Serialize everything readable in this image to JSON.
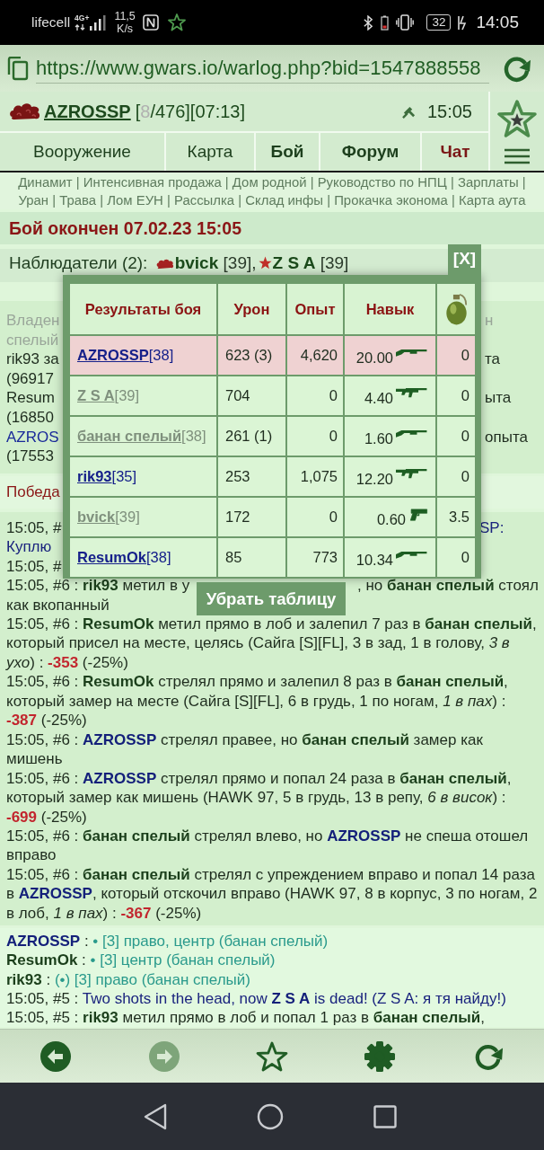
{
  "status_bar": {
    "carrier": "lifecell",
    "network": "4G+",
    "speed": "11,5",
    "speed_unit": "K/s",
    "battery": "32",
    "time": "14:05"
  },
  "address_bar": {
    "url": "https://www.gwars.io/warlog.php?bid=1547888558"
  },
  "header": {
    "player": "AZROSSP",
    "stats": {
      "before": "[",
      "hp": "8",
      "after": "/476][07:13]"
    },
    "time": "15:05",
    "nav": [
      {
        "label": "Вооружение",
        "kind": "plain"
      },
      {
        "label": "Карта",
        "kind": "plain"
      },
      {
        "label": "Бой",
        "kind": "bold"
      },
      {
        "label": "Форум",
        "kind": "bold"
      },
      {
        "label": "Чат",
        "kind": "alert"
      }
    ]
  },
  "quick_links": [
    {
      "label": "Динамит",
      "separator": "|"
    },
    {
      "label": "Интенсивная продажа",
      "separator": "|"
    },
    {
      "label": "Дом родной",
      "separator": "|"
    },
    {
      "label": "Руководство по НПЦ",
      "separator": "|"
    },
    {
      "label": "Зарплаты",
      "separator": "|"
    },
    {
      "label": "Уран",
      "separator": "|"
    },
    {
      "label": "Трава",
      "separator": "|"
    },
    {
      "label": "Лом ЕУН",
      "separator": "|"
    },
    {
      "label": "Рассылка",
      "separator": "|"
    },
    {
      "label": "Склад инфы",
      "separator": "|"
    },
    {
      "label": "Прокачка эконома",
      "separator": "|"
    },
    {
      "label": "Карта аута"
    }
  ],
  "battle": {
    "title": "Бой окончен 07.02.23 15:05",
    "observers": {
      "label": "Наблюдатели (2):",
      "players": [
        {
          "name": "bvick",
          "level": "[39],",
          "clan": {
            "kind": "cloud"
          }
        },
        {
          "name": "Z S A",
          "level": "[39]",
          "clan": {
            "kind": "star"
          }
        }
      ]
    },
    "summary_lines": [
      {
        "left": [
          {
            "text": "Владен",
            "kind": "muted"
          }
        ],
        "right": [
          {
            "text": "н",
            "kind": "muted"
          }
        ]
      },
      {
        "left": [
          {
            "text": "спелый",
            "kind": "muted"
          }
        ]
      },
      {
        "left": [
          {
            "text": "rik93 за"
          }
        ],
        "right": [
          {
            "text": "та"
          }
        ]
      },
      {
        "left": [
          {
            "text": "(96917"
          }
        ]
      },
      {
        "left": [
          {
            "text": "Resum"
          }
        ],
        "right": [
          {
            "text": "ыта"
          }
        ]
      },
      {
        "left": [
          {
            "text": "(16850"
          }
        ]
      },
      {
        "left": [
          {
            "text": "AZROS",
            "kind": "name"
          }
        ],
        "right": [
          {
            "text": "опыта"
          }
        ]
      },
      {
        "left": [
          {
            "text": "(17553"
          }
        ]
      }
    ],
    "victory": "Победа",
    "covered_lines": [
      {
        "left": [
          {
            "text": "15:05, #"
          }
        ],
        "right": [
          {
            "text": "SP:",
            "kind": "message"
          }
        ]
      },
      {
        "left": [
          {
            "text": "Куплю",
            "kind": "message"
          }
        ]
      },
      {
        "left": [
          {
            "text": "15:05, #"
          }
        ]
      }
    ],
    "button_line": {
      "left": [
        {
          "text": "15:05, #6 : "
        },
        {
          "text": "rik93",
          "kind": "player",
          "color": "#1b3f1b"
        },
        {
          "text": " метил в у"
        }
      ],
      "right": [
        {
          "text": ", но "
        },
        {
          "text": "банан спелый",
          "kind": "player",
          "color": "#1b3f1b"
        },
        {
          "text": " стоял"
        }
      ]
    },
    "entries": [
      {
        "segments": [
          {
            "text": "как вкопанный"
          }
        ]
      },
      {
        "segments": [
          {
            "text": "15:05, #6 : "
          },
          {
            "text": "ResumOk",
            "kind": "player",
            "color": "#1b3f1b"
          },
          {
            "text": " метил прямо в лоб и залепил 7 раз в "
          },
          {
            "text": "банан спелый",
            "kind": "player",
            "color": "#1b3f1b"
          },
          {
            "text": ", который присел на месте, целясь (Сайга [S][FL], 3 в зад, 1 в голову, "
          },
          {
            "text": "3 в ухо",
            "kind": "italic"
          },
          {
            "text": ") : "
          },
          {
            "text": "-353",
            "kind": "damage"
          },
          {
            "text": " (-25%)"
          }
        ]
      },
      {
        "segments": [
          {
            "text": "15:05, #6 : "
          },
          {
            "text": "ResumOk",
            "kind": "player",
            "color": "#1b3f1b"
          },
          {
            "text": " стрелял прямо и залепил 8 раз в "
          },
          {
            "text": "банан спелый",
            "kind": "player",
            "color": "#1b3f1b"
          },
          {
            "text": ", который замер на месте (Сайга [S][FL], 6 в грудь, 1 по ногам, "
          },
          {
            "text": "1 в пах",
            "kind": "italic"
          },
          {
            "text": ") : "
          },
          {
            "text": "-387",
            "kind": "damage"
          },
          {
            "text": " (-25%)"
          }
        ]
      },
      {
        "segments": [
          {
            "text": "15:05, #6 : "
          },
          {
            "text": "AZROSSP",
            "kind": "player",
            "color": "#14207a"
          },
          {
            "text": " стрелял правее, но "
          },
          {
            "text": "банан спелый",
            "kind": "player",
            "color": "#1b3f1b"
          },
          {
            "text": " замер как мишень"
          }
        ]
      },
      {
        "segments": [
          {
            "text": "15:05, #6 : "
          },
          {
            "text": "AZROSSP",
            "kind": "player",
            "color": "#14207a"
          },
          {
            "text": " стрелял прямо и попал 24 раза в "
          },
          {
            "text": "банан спелый",
            "kind": "player",
            "color": "#1b3f1b"
          },
          {
            "text": ", который замер как мишень (HAWK 97, 5 в грудь, 13 в репу, "
          },
          {
            "text": "6 в висок",
            "kind": "italic"
          },
          {
            "text": ") : "
          },
          {
            "text": "-699",
            "kind": "damage"
          },
          {
            "text": " (-25%)"
          }
        ]
      },
      {
        "segments": [
          {
            "text": "15:05, #6 : "
          },
          {
            "text": "банан спелый",
            "kind": "player",
            "color": "#1b3f1b"
          },
          {
            "text": " стрелял влево, но "
          },
          {
            "text": "AZROSSP",
            "kind": "player",
            "color": "#14207a"
          },
          {
            "text": " не спеша отошел вправо"
          }
        ]
      },
      {
        "segments": [
          {
            "text": "15:05, #6 : "
          },
          {
            "text": "банан спелый",
            "kind": "player",
            "color": "#1b3f1b"
          },
          {
            "text": " стрелял с упреждением вправо и попал 14 раза в "
          },
          {
            "text": "AZROSSP",
            "kind": "player",
            "color": "#14207a"
          },
          {
            "text": ", который отскочил вправо (HAWK 97, 8 в корпус, 3 по ногам, 2 в лоб, "
          },
          {
            "text": "1 в пах",
            "kind": "italic"
          },
          {
            "text": ") : "
          },
          {
            "text": "-367",
            "kind": "damage"
          },
          {
            "text": " (-25%)"
          }
        ]
      }
    ],
    "aim_lines": [
      {
        "segments": [
          {
            "text": "AZROSSP",
            "kind": "player",
            "color": "#14207a"
          },
          {
            "text": " : "
          },
          {
            "text": "• [3] право, центр (банан спелый)",
            "kind": "aim"
          }
        ]
      },
      {
        "segments": [
          {
            "text": "ResumOk",
            "kind": "player",
            "color": "#1b3f1b"
          },
          {
            "text": " : "
          },
          {
            "text": "• [3] центр (банан спелый)",
            "kind": "aim"
          }
        ]
      },
      {
        "segments": [
          {
            "text": "rik93",
            "kind": "player",
            "color": "#1b3f1b"
          },
          {
            "text": " : "
          },
          {
            "text": "(•) [3] право (банан спелый)",
            "kind": "aim"
          }
        ]
      },
      {
        "segments": [
          {
            "text": "15:05, #5 : "
          },
          {
            "text": "Two shots in the head, now ",
            "kind": "message"
          },
          {
            "text": "Z S A",
            "kind": "player",
            "color": "#14207a"
          },
          {
            "text": " is dead! (Z S A: я тя найду!)",
            "kind": "message"
          }
        ]
      },
      {
        "segments": [
          {
            "text": "15:05, #5 : "
          },
          {
            "text": "rik93",
            "kind": "player",
            "color": "#1b3f1b"
          },
          {
            "text": " метил прямо в лоб и попал 1 раз в "
          },
          {
            "text": "банан спелый",
            "kind": "player",
            "color": "#1b3f1b"
          },
          {
            "text": ","
          }
        ]
      }
    ]
  },
  "results": {
    "close": "[X]",
    "columns": [
      "Результаты боя",
      "Урон",
      "Опыт",
      "Навык"
    ],
    "rows": [
      {
        "name": "AZROSSP",
        "level": "[38]",
        "damage": "623 (3)",
        "experience": "4,620",
        "skill": "20.00",
        "weapon": {
          "kind": "shotgun"
        },
        "grenade": "0",
        "highlighted": true,
        "dimmed": false
      },
      {
        "name": "Z S A",
        "level": "[39]",
        "damage": "704",
        "experience": "0",
        "skill": "4.40",
        "weapon": {
          "kind": "rifle"
        },
        "grenade": "0",
        "highlighted": false,
        "dimmed": true
      },
      {
        "name": "банан спелый",
        "level": "[38]",
        "damage": "261 (1)",
        "experience": "0",
        "skill": "1.60",
        "weapon": {
          "kind": "shotgun"
        },
        "grenade": "0",
        "highlighted": false,
        "dimmed": true
      },
      {
        "name": "rik93",
        "level": "[35]",
        "damage": "253",
        "experience": "1,075",
        "skill": "12.20",
        "weapon": {
          "kind": "rifle"
        },
        "grenade": "0",
        "highlighted": false,
        "dimmed": false
      },
      {
        "name": "bvick",
        "level": "[39]",
        "damage": "172",
        "experience": "0",
        "skill": "0.60",
        "weapon": {
          "kind": "pistol"
        },
        "grenade": "3.5",
        "highlighted": false,
        "dimmed": true
      },
      {
        "name": "ResumOk",
        "level": "[38]",
        "damage": "85",
        "experience": "773",
        "skill": "10.34",
        "weapon": {
          "kind": "shotgun"
        },
        "grenade": "0",
        "highlighted": false,
        "dimmed": false
      }
    ],
    "hide": "Убрать таблицу"
  },
  "toolbar": [
    {
      "kind": "back",
      "disabled": false
    },
    {
      "kind": "forward",
      "disabled": true
    },
    {
      "kind": "bookmark",
      "disabled": false
    },
    {
      "kind": "settings",
      "disabled": false
    },
    {
      "kind": "reload",
      "disabled": false
    }
  ]
}
